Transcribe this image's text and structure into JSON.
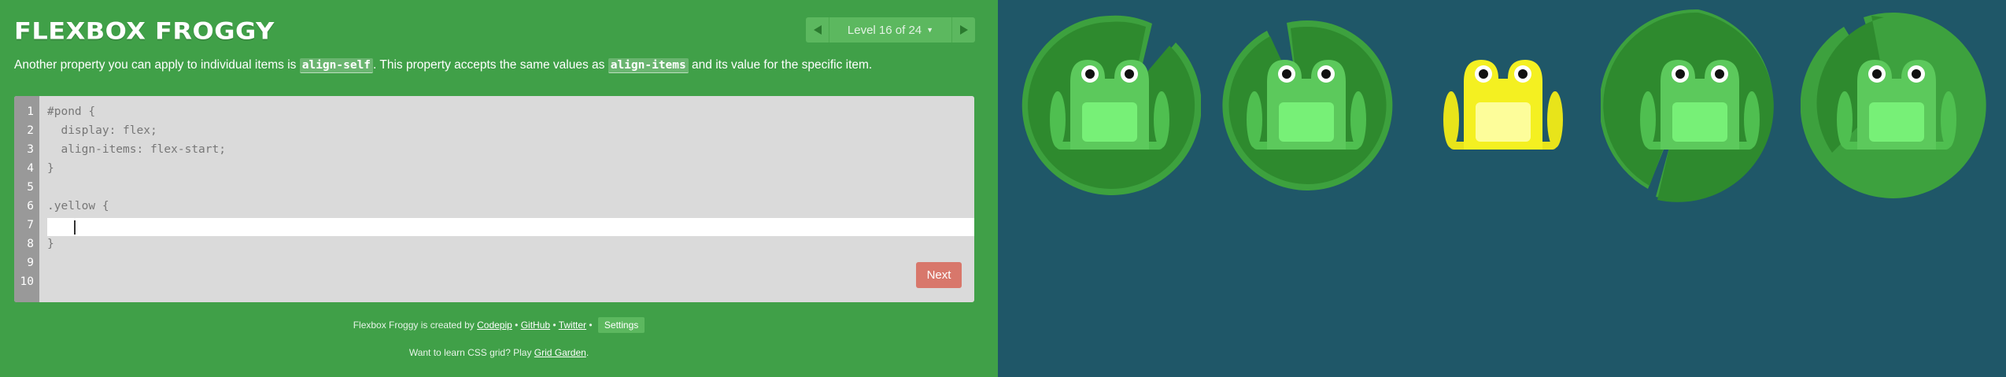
{
  "app": {
    "title": "FLEXBOX FROGGY"
  },
  "level_nav": {
    "label": "Level 16 of 24",
    "prev_icon": "triangle-left-icon",
    "next_icon": "triangle-right-icon",
    "dropdown_icon": "caret-down-icon"
  },
  "instructions": {
    "part1": "Another property you can apply to individual items is ",
    "code1": "align-self",
    "part2": ". This property accepts the same values as ",
    "code2": "align-items",
    "part3": " and its value for the specific item."
  },
  "editor": {
    "line_numbers": [
      "1",
      "2",
      "3",
      "4",
      "5",
      "6",
      "7",
      "8",
      "9",
      "10"
    ],
    "lines": [
      "#pond {",
      "  display: flex;",
      "  align-items: flex-start;",
      "}",
      "",
      ".yellow {",
      "",
      "}",
      "",
      ""
    ],
    "input_value": "",
    "next_label": "Next"
  },
  "footer": {
    "credit_prefix": "Flexbox Froggy is created by ",
    "codepip": "Codepip",
    "sep1": " • ",
    "github": "GitHub",
    "sep2": " • ",
    "twitter": "Twitter",
    "sep3": " • ",
    "settings": "Settings",
    "grid_prefix": "Want to learn CSS grid? Play ",
    "grid_link": "Grid Garden",
    "grid_suffix": "."
  },
  "colors": {
    "sidebar_bg": "#40a048",
    "pond_bg": "#1f5768",
    "lilypad": "#2e8a2e",
    "lilypad_light": "#3da13e",
    "frog_green": "#5cc95c",
    "frog_green_belly": "#77f077",
    "frog_yellow": "#f4f021",
    "frog_yellow_belly": "#fdfd9a",
    "next_button": "#d8776b"
  },
  "pond": {
    "frogs": [
      {
        "color": "green"
      },
      {
        "color": "green"
      },
      {
        "color": "yellow"
      },
      {
        "color": "green"
      },
      {
        "color": "green"
      }
    ],
    "lilypads": 4
  }
}
